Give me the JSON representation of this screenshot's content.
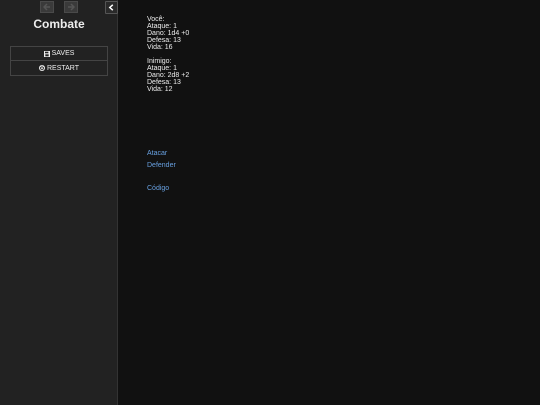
{
  "sidebar": {
    "title": "Combate",
    "saves_label": "SAVES",
    "restart_label": "RESTART"
  },
  "passage": {
    "player": {
      "heading": "Você:",
      "attack": "Ataque: 1",
      "damage": "Dano: 1d4 +0",
      "defense": "Defesa: 13",
      "life": "Vida: 16"
    },
    "enemy": {
      "heading": "Inimigo:",
      "attack": "Ataque: 1",
      "damage": "Dano: 2d8 +2",
      "defense": "Defesa: 13",
      "life": "Vida: 12"
    },
    "links": {
      "attack": "Atacar",
      "defend": "Defender",
      "code": "Código"
    }
  },
  "colors": {
    "background": "#111111",
    "sidebar": "#222222",
    "text": "#eeeeee",
    "link": "#68a0e0"
  }
}
